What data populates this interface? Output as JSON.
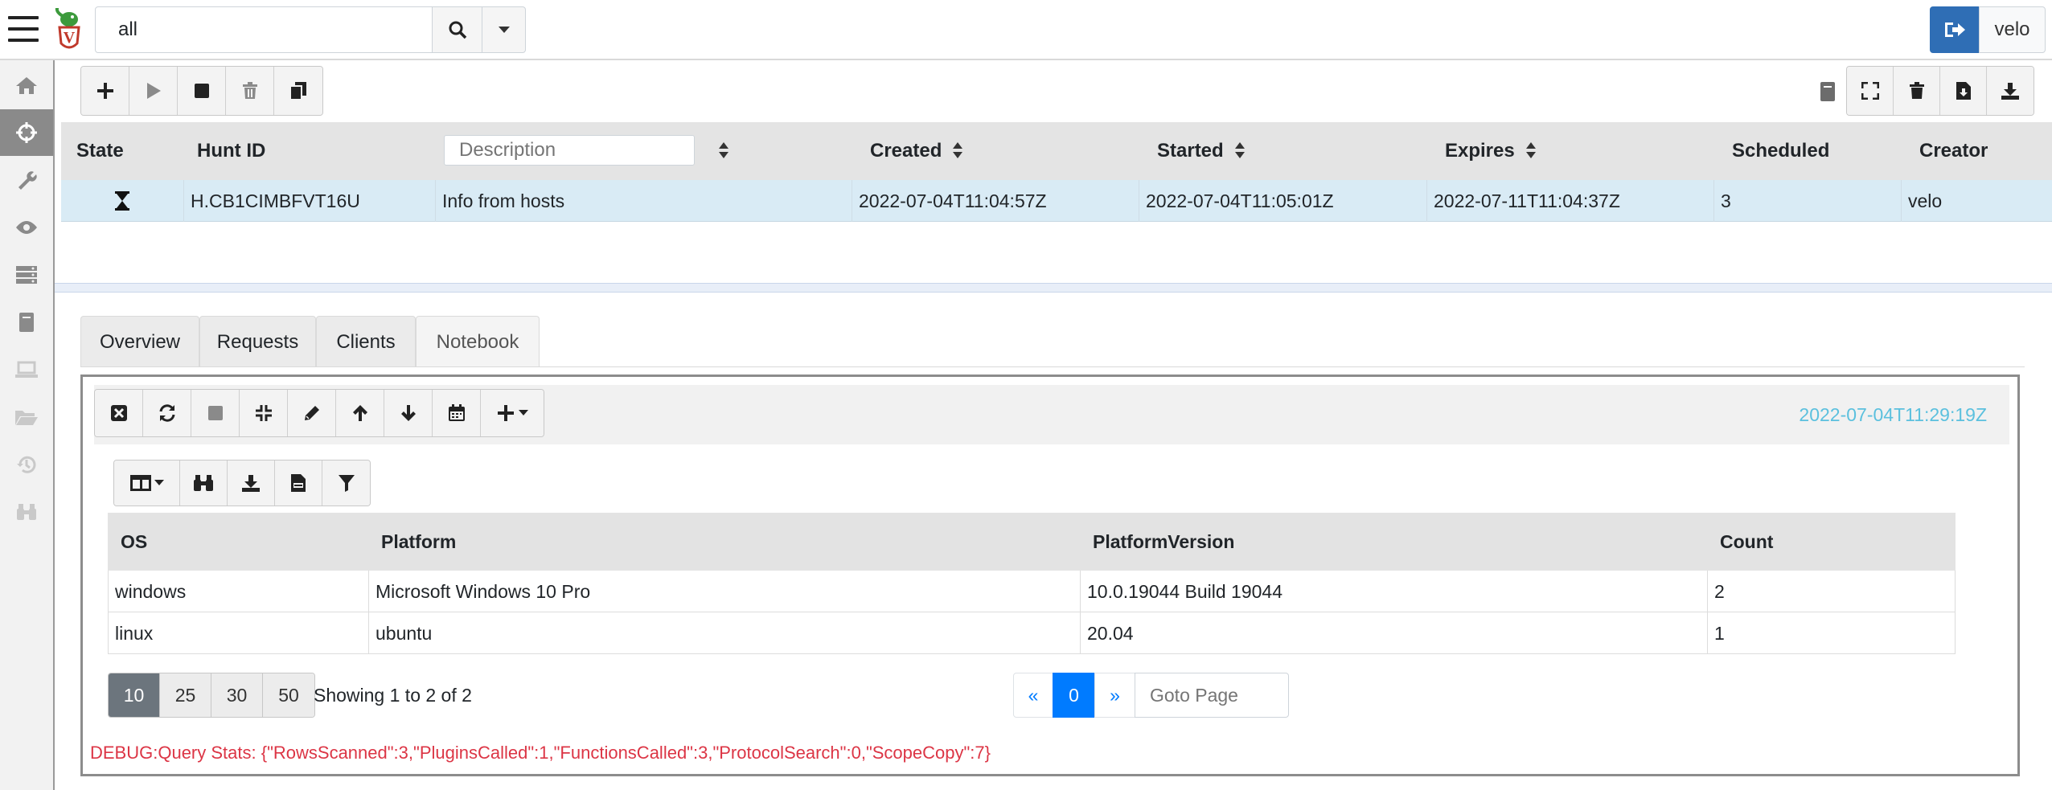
{
  "search": {
    "value": "all"
  },
  "user": {
    "name": "velo"
  },
  "sidebar": {
    "items": [
      {
        "icon": "home-icon"
      },
      {
        "icon": "crosshairs-icon"
      },
      {
        "icon": "wrench-icon"
      },
      {
        "icon": "eye-icon"
      },
      {
        "icon": "server-icon"
      },
      {
        "icon": "book-icon"
      },
      {
        "icon": "laptop-icon"
      },
      {
        "icon": "folder-open-icon"
      },
      {
        "icon": "history-icon"
      },
      {
        "icon": "binoculars-icon"
      }
    ]
  },
  "hunts": {
    "columns": {
      "state": "State",
      "hunt_id": "Hunt ID",
      "description_placeholder": "Description",
      "created": "Created",
      "started": "Started",
      "expires": "Expires",
      "scheduled": "Scheduled",
      "creator": "Creator"
    },
    "rows": [
      {
        "state_icon": "hourglass-icon",
        "hunt_id": "H.CB1CIMBFVT16U",
        "description": "Info from hosts",
        "created": "2022-07-04T11:04:57Z",
        "started": "2022-07-04T11:05:01Z",
        "expires": "2022-07-11T11:04:37Z",
        "scheduled": "3",
        "creator": "velo"
      }
    ]
  },
  "tabs": [
    {
      "label": "Overview"
    },
    {
      "label": "Requests"
    },
    {
      "label": "Clients"
    },
    {
      "label": "Notebook",
      "active": true
    }
  ],
  "notebook": {
    "timestamp": "2022-07-04T11:29:19Z",
    "results": {
      "columns": [
        "OS",
        "Platform",
        "PlatformVersion",
        "Count"
      ],
      "rows": [
        [
          "windows",
          "Microsoft Windows 10 Pro",
          "10.0.19044 Build 19044",
          "2"
        ],
        [
          "linux",
          "ubuntu",
          "20.04",
          "1"
        ]
      ]
    },
    "pagination": {
      "page_sizes": [
        "10",
        "25",
        "30",
        "50"
      ],
      "selected_size": "10",
      "showing": "Showing 1 to 2 of 2",
      "prev": "«",
      "current_page": "0",
      "next": "»",
      "goto_placeholder": "Goto Page"
    },
    "debug": "DEBUG:Query Stats: {\"RowsScanned\":3,\"PluginsCalled\":1,\"FunctionsCalled\":3,\"ProtocolSearch\":0,\"ScopeCopy\":7}"
  },
  "colors": {
    "accent": "#2f6eb5",
    "selected_row": "#d9ebf5",
    "timestamp": "#5bc0de",
    "debug": "#dc3545",
    "page_active": "#007bff"
  }
}
